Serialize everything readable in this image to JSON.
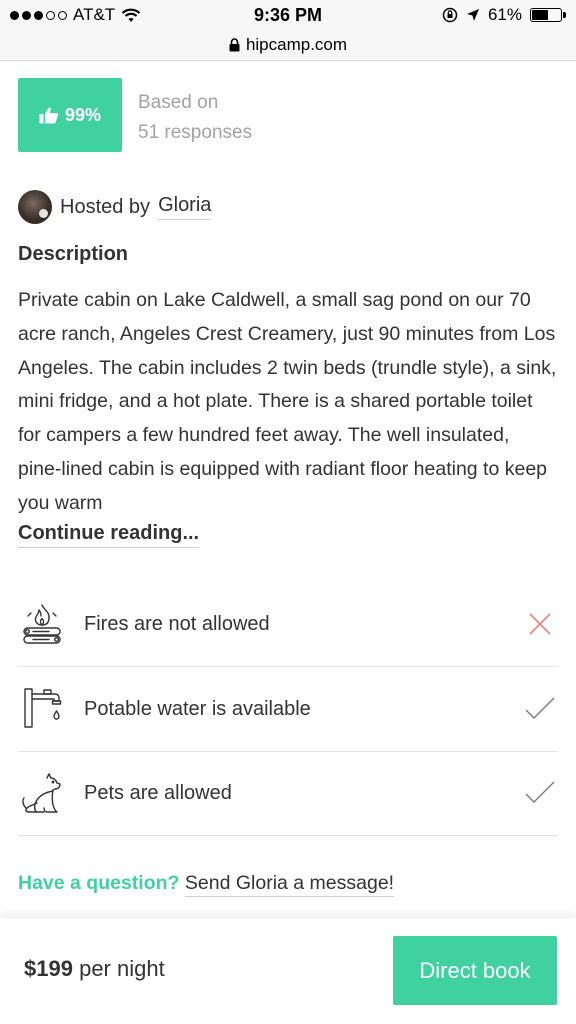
{
  "status_bar": {
    "carrier": "AT&T",
    "time": "9:36 PM",
    "battery_percent": "61%",
    "battery_level": 0.61
  },
  "browser": {
    "url": "hipcamp.com"
  },
  "rating": {
    "percent": "99%",
    "caption_line1": "Based on",
    "caption_line2": "51 responses",
    "accent_color": "#3fd2a0"
  },
  "host": {
    "prefix": "Hosted by",
    "name": "Gloria"
  },
  "description": {
    "heading": "Description",
    "body": "Private cabin on Lake Caldwell, a small sag pond on our 70 acre ranch, Angeles Crest Creamery, just 90 minutes from Los Angeles. The cabin includes 2 twin beds (trundle style), a sink, mini fridge, and a hot plate. There is a shared portable toilet for campers a few hundred feet away. The well insulated, pine-lined cabin is equipped with radiant floor heating to keep you warm",
    "continue_label": "Continue reading..."
  },
  "amenities": [
    {
      "icon": "campfire-icon",
      "label": "Fires are not allowed",
      "status": "not-allowed"
    },
    {
      "icon": "faucet-icon",
      "label": "Potable water is available",
      "status": "allowed"
    },
    {
      "icon": "dog-icon",
      "label": "Pets are allowed",
      "status": "allowed"
    }
  ],
  "question": {
    "prompt": "Have a question?",
    "link": "Send Gloria a message!"
  },
  "footer": {
    "price": "$199",
    "unit": "per night",
    "book_label": "Direct book"
  },
  "colors": {
    "accent": "#3fd2a0",
    "cross": "#e8847c",
    "check": "#7a7a7a"
  }
}
